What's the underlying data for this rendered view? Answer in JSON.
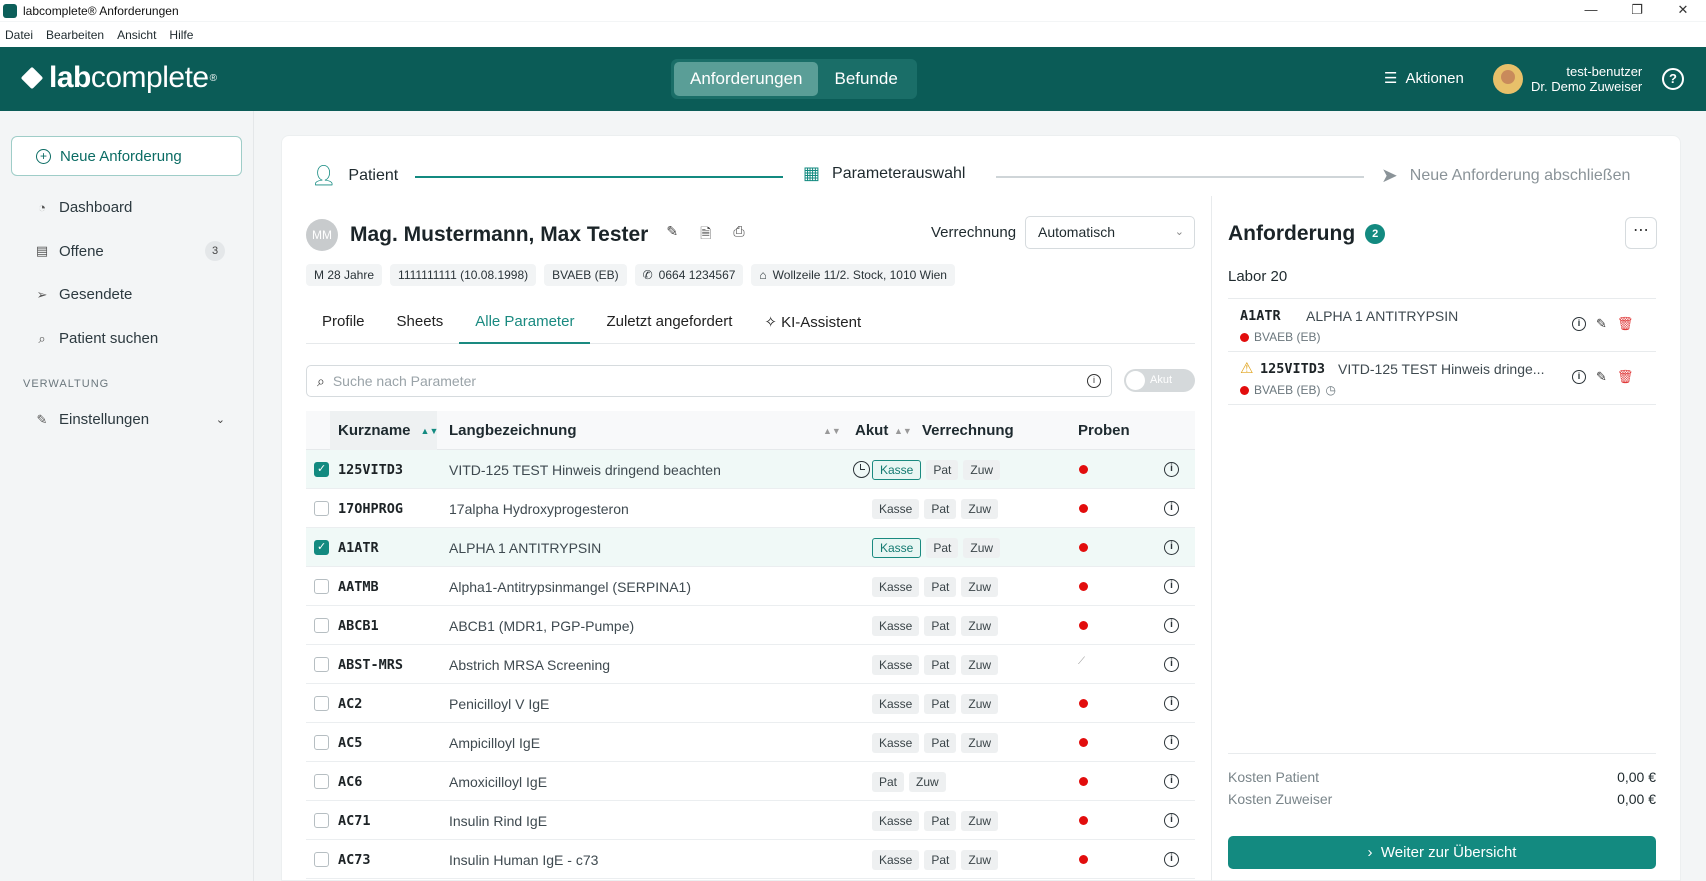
{
  "window": {
    "title": "labcomplete® Anforderungen",
    "controls": [
      "—",
      "❐",
      "✕"
    ]
  },
  "menu": [
    "Datei",
    "Bearbeiten",
    "Ansicht",
    "Hilfe"
  ],
  "header": {
    "logo_bold": "lab",
    "logo_light": "complete",
    "logo_mark": "®",
    "tabs": [
      {
        "label": "Anforderungen",
        "active": true
      },
      {
        "label": "Befunde",
        "active": false
      }
    ],
    "actions_label": "Aktionen",
    "user_name": "test-benutzer",
    "user_org": "Dr. Demo Zuweiser",
    "help_icon": "help-icon"
  },
  "sidebar": {
    "new_request": "Neue Anforderung",
    "items": [
      {
        "label": "Dashboard",
        "icon": "dashboard-icon"
      },
      {
        "label": "Offene",
        "icon": "list-icon",
        "badge": "3"
      },
      {
        "label": "Gesendete",
        "icon": "send-icon"
      },
      {
        "label": "Patient suchen",
        "icon": "search-icon"
      }
    ],
    "section": "VERWALTUNG",
    "settings": "Einstellungen"
  },
  "stepper": {
    "step1": "Patient",
    "step2": "Parameterauswahl",
    "step3": "Neue Anforderung abschließen"
  },
  "patient": {
    "initials": "MM",
    "name": "Mag. Mustermann, Max Tester",
    "verrechnung_label": "Verrechnung",
    "verrechnung_value": "Automatisch",
    "chips": {
      "age": "M 28 Jahre",
      "svnr": "1111111111 (10.08.1998)",
      "insurance": "BVAEB (EB)",
      "phone": "0664 1234567",
      "address": "Wollzeile 11/2. Stock, 1010 Wien"
    }
  },
  "subtabs": [
    {
      "label": "Profile",
      "active": false
    },
    {
      "label": "Sheets",
      "active": false
    },
    {
      "label": "Alle Parameter",
      "active": true
    },
    {
      "label": "Zuletzt angefordert",
      "active": false
    },
    {
      "label": "KI-Assistent",
      "active": false
    }
  ],
  "search": {
    "placeholder": "Suche nach Parameter",
    "akut_toggle": "Akut"
  },
  "table": {
    "headers": {
      "kurz": "Kurzname",
      "lang": "Langbezeichnung",
      "akut": "Akut",
      "verr": "Verrechnung",
      "proben": "Proben"
    },
    "rows": [
      {
        "kurz": "125VITD3",
        "lang": "VITD-125 TEST Hinweis dringend beachten",
        "checked": true,
        "akut": true,
        "pills": [
          "Kasse",
          "Pat",
          "Zuw"
        ],
        "kasse_on": true,
        "probe": "red"
      },
      {
        "kurz": "17OHPROG",
        "lang": "17alpha Hydroxyprogesteron",
        "checked": false,
        "akut": false,
        "pills": [
          "Kasse",
          "Pat",
          "Zuw"
        ],
        "kasse_on": false,
        "probe": "red"
      },
      {
        "kurz": "A1ATR",
        "lang": "ALPHA 1 ANTITRYPSIN",
        "checked": true,
        "akut": false,
        "pills": [
          "Kasse",
          "Pat",
          "Zuw"
        ],
        "kasse_on": true,
        "probe": "red"
      },
      {
        "kurz": "AATMB",
        "lang": "Alpha1-Antitrypsinmangel (SERPINA1)",
        "checked": false,
        "akut": false,
        "pills": [
          "Kasse",
          "Pat",
          "Zuw"
        ],
        "kasse_on": false,
        "probe": "red"
      },
      {
        "kurz": "ABCB1",
        "lang": "ABCB1 (MDR1, PGP-Pumpe)",
        "checked": false,
        "akut": false,
        "pills": [
          "Kasse",
          "Pat",
          "Zuw"
        ],
        "kasse_on": false,
        "probe": "red"
      },
      {
        "kurz": "ABST-MRS",
        "lang": "Abstrich MRSA Screening",
        "checked": false,
        "akut": false,
        "pills": [
          "Kasse",
          "Pat",
          "Zuw"
        ],
        "kasse_on": false,
        "probe": "slash"
      },
      {
        "kurz": "AC2",
        "lang": "Penicilloyl V IgE",
        "checked": false,
        "akut": false,
        "pills": [
          "Kasse",
          "Pat",
          "Zuw"
        ],
        "kasse_on": false,
        "probe": "red"
      },
      {
        "kurz": "AC5",
        "lang": "Ampicilloyl IgE",
        "checked": false,
        "akut": false,
        "pills": [
          "Kasse",
          "Pat",
          "Zuw"
        ],
        "kasse_on": false,
        "probe": "red"
      },
      {
        "kurz": "AC6",
        "lang": "Amoxicilloyl IgE",
        "checked": false,
        "akut": false,
        "pills": [
          "Pat",
          "Zuw"
        ],
        "kasse_on": false,
        "probe": "red"
      },
      {
        "kurz": "AC71",
        "lang": "Insulin Rind IgE",
        "checked": false,
        "akut": false,
        "pills": [
          "Kasse",
          "Pat",
          "Zuw"
        ],
        "kasse_on": false,
        "probe": "red"
      },
      {
        "kurz": "AC73",
        "lang": "Insulin Human IgE - c73",
        "checked": false,
        "akut": false,
        "pills": [
          "Kasse",
          "Pat",
          "Zuw"
        ],
        "kasse_on": false,
        "probe": "red"
      }
    ]
  },
  "anforderung": {
    "title": "Anforderung",
    "count": "2",
    "labor": "Labor 20",
    "items": [
      {
        "code": "A1ATR",
        "desc": "ALPHA 1 ANTITRYPSIN",
        "sub": "BVAEB (EB)",
        "warn": false
      },
      {
        "code": "125VITD3",
        "desc": "VITD-125 TEST Hinweis dringe...",
        "sub": "BVAEB (EB)",
        "warn": true
      }
    ],
    "kosten_patient_label": "Kosten Patient",
    "kosten_patient": "0,00 €",
    "kosten_zuweiser_label": "Kosten Zuweiser",
    "kosten_zuweiser": "0,00 €",
    "weiter": "Weiter zur Übersicht"
  }
}
